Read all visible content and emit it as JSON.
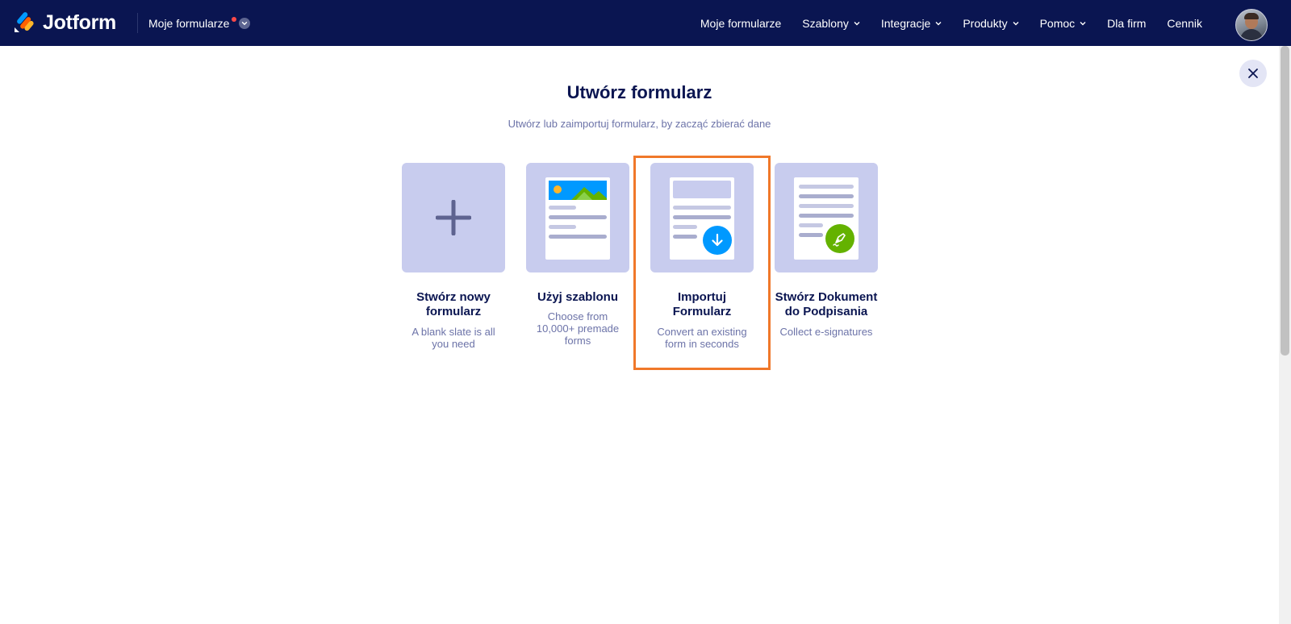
{
  "brand": {
    "name": "Jotform"
  },
  "header": {
    "switch_label": "Moje formularze",
    "nav": [
      {
        "label": "Moje formularze",
        "dropdown": false
      },
      {
        "label": "Szablony",
        "dropdown": true
      },
      {
        "label": "Integracje",
        "dropdown": true
      },
      {
        "label": "Produkty",
        "dropdown": true
      },
      {
        "label": "Pomoc",
        "dropdown": true
      },
      {
        "label": "Dla firm",
        "dropdown": false
      },
      {
        "label": "Cennik",
        "dropdown": false
      }
    ]
  },
  "modal": {
    "title": "Utwórz formularz",
    "subtitle": "Utwórz lub zaimportuj formularz, by zacząć zbierać dane",
    "cards": [
      {
        "title_lines": [
          "Stwórz nowy",
          "formularz"
        ],
        "desc_lines": [
          "A blank slate is all",
          "you need"
        ],
        "icon": "plus-icon"
      },
      {
        "title_lines": [
          "Użyj szablonu"
        ],
        "desc_lines": [
          "Choose from",
          "10,000+ premade",
          "forms"
        ],
        "icon": "template-icon"
      },
      {
        "title_lines": [
          "Importuj",
          "Formularz"
        ],
        "desc_lines": [
          "Convert an existing",
          "form in seconds"
        ],
        "icon": "import-icon",
        "selected": true
      },
      {
        "title_lines": [
          "Stwórz Dokument",
          "do Podpisania"
        ],
        "desc_lines": [
          "Collect e-signatures"
        ],
        "icon": "signature-icon"
      }
    ]
  },
  "colors": {
    "nav_bg": "#0a1551",
    "tile_bg": "#c8ccee",
    "highlight": "#f0782a",
    "import_blue": "#0099ff",
    "sign_green": "#64b200",
    "notification": "#ff4948"
  }
}
